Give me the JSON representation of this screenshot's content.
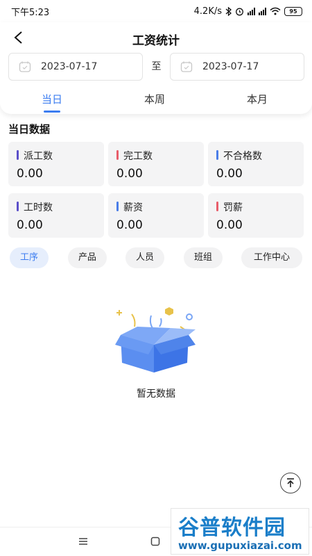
{
  "status_bar": {
    "time": "下午5:23",
    "speed": "4.2K/s",
    "battery": "95"
  },
  "header": {
    "title": "工资统计"
  },
  "date_range": {
    "start": "2023-07-17",
    "separator": "至",
    "end": "2023-07-17"
  },
  "tabs": [
    {
      "label": "当日",
      "active": true
    },
    {
      "label": "本周",
      "active": false
    },
    {
      "label": "本月",
      "active": false
    }
  ],
  "section": {
    "title": "当日数据"
  },
  "stats": [
    {
      "label": "派工数",
      "value": "0.00",
      "color": "#5b4fc9"
    },
    {
      "label": "完工数",
      "value": "0.00",
      "color": "#e85d6a"
    },
    {
      "label": "不合格数",
      "value": "0.00",
      "color": "#4a7de8"
    },
    {
      "label": "工时数",
      "value": "0.00",
      "color": "#5b4fc9"
    },
    {
      "label": "薪资",
      "value": "0.00",
      "color": "#4a7de8"
    },
    {
      "label": "罚薪",
      "value": "0.00",
      "color": "#e85d6a"
    }
  ],
  "filter_chips": [
    {
      "label": "工序",
      "active": true
    },
    {
      "label": "产品",
      "active": false
    },
    {
      "label": "人员",
      "active": false
    },
    {
      "label": "班组",
      "active": false
    },
    {
      "label": "工作中心",
      "active": false
    }
  ],
  "empty_state": {
    "text": "暂无数据"
  },
  "watermark": {
    "title": "谷普软件园",
    "url": "www.gupuxiazai.com"
  },
  "colors": {
    "accent": "#3b7cf0",
    "card_bg": "#f4f4f5"
  }
}
